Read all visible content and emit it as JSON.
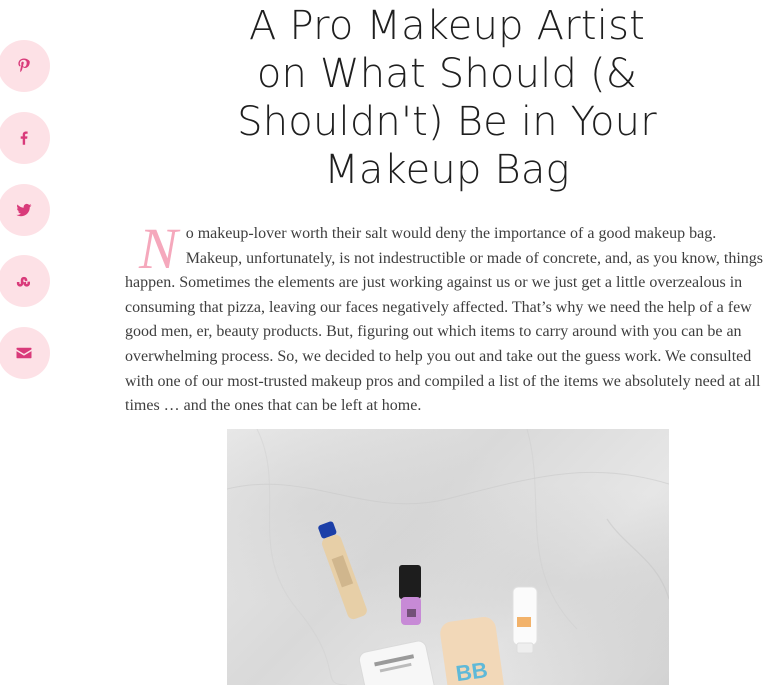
{
  "share": {
    "buttons": [
      {
        "name": "pinterest-icon"
      },
      {
        "name": "facebook-icon"
      },
      {
        "name": "twitter-icon"
      },
      {
        "name": "stumbleupon-icon"
      },
      {
        "name": "email-icon"
      }
    ],
    "accent_color": "#d93a7a",
    "button_bg": "#fde1e6"
  },
  "article": {
    "title": "A Pro Makeup Artist on What Should (& Shouldn't) Be in Your Makeup Bag",
    "dropcap": "N",
    "body": "o makeup-lover worth their salt would deny the importance of a good makeup bag. Makeup, unfortunately, is not indestructible or made of concrete, and, as you know, things happen. Sometimes the elements are just working against us or we just get a little overzealous in consuming that pizza, leaving our faces negatively affected. That’s why we need the help of a few good men, er, beauty products. But, figuring out which items to carry around with you can be an overwhelming process. So, we decided to help you out and take out the guess work. We consulted with one of our most-trusted makeup pros and compiled a list of the items we absolutely need at all times … and the ones that can be left at home.",
    "image": {
      "bb_label": "BB"
    }
  }
}
